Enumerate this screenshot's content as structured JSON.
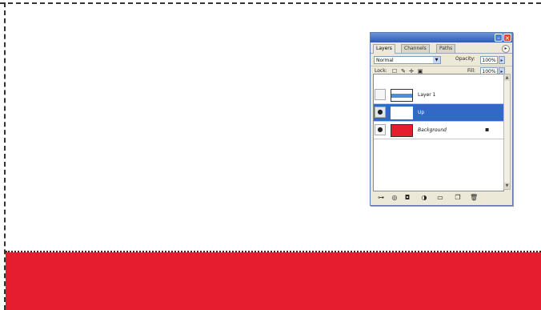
{
  "panel": {
    "tabs": [
      {
        "label": "Layers",
        "active": true
      },
      {
        "label": "Channels",
        "active": false
      },
      {
        "label": "Paths",
        "active": false
      }
    ],
    "blend_mode": "Normal",
    "opacity_label": "Opacity:",
    "opacity_value": "100%",
    "lock_label": "Lock:",
    "fill_label": "Fill:",
    "fill_value": "100%",
    "layers": [
      {
        "name": "Layer 1",
        "visible": false,
        "selected": false,
        "thumb": "white-blue"
      },
      {
        "name": "Up",
        "visible": true,
        "selected": true,
        "thumb": "white"
      },
      {
        "name": "Background",
        "visible": true,
        "selected": false,
        "thumb": "red",
        "locked": true
      }
    ]
  },
  "colors": {
    "red_fill": "#e51d2e",
    "selection": "#316ac5",
    "panel_bg": "#ece9d8"
  }
}
